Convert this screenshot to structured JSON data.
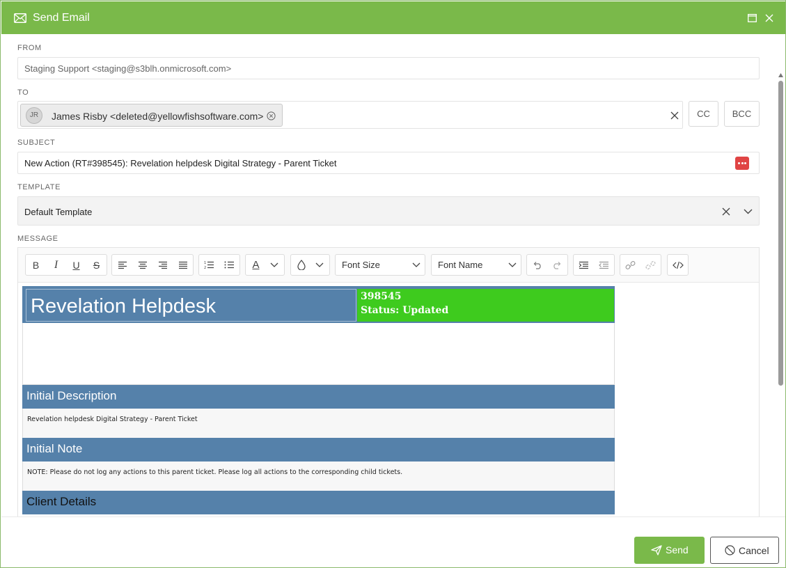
{
  "window": {
    "title": "Send Email"
  },
  "from": {
    "label": "FROM",
    "value": "Staging Support <staging@s3blh.onmicrosoft.com>"
  },
  "to": {
    "label": "TO",
    "recipients": [
      {
        "initials": "JR",
        "display": "James Risby <deleted@yellowfishsoftware.com>"
      }
    ],
    "cc_label": "CC",
    "bcc_label": "BCC"
  },
  "subject": {
    "label": "SUBJECT",
    "value": "New Action (RT#398545): Revelation helpdesk Digital Strategy - Parent Ticket"
  },
  "template": {
    "label": "TEMPLATE",
    "value": "Default Template"
  },
  "message": {
    "label": "MESSAGE",
    "toolbar": {
      "bold": "B",
      "italic": "I",
      "underline": "U",
      "strikethrough": "S",
      "font_color": "A",
      "font_size": "Font Size",
      "font_name": "Font Name"
    },
    "email": {
      "brand": "Revelation Helpdesk",
      "ticket_number": "398545",
      "status": "Status: Updated",
      "sections": [
        {
          "heading": "Initial Description",
          "body": "Revelation helpdesk Digital Strategy - Parent Ticket"
        },
        {
          "heading": "Initial Note",
          "body": "NOTE: Please do not log any actions to this parent ticket. Please log all actions to the corresponding child tickets."
        },
        {
          "heading": "Client Details",
          "body": ""
        }
      ]
    }
  },
  "footer": {
    "send_label": "Send",
    "cancel_label": "Cancel"
  },
  "colors": {
    "header_green": "#7ab94a",
    "template_blue": "#5581aa",
    "status_green": "#3ecb1e",
    "alert_red": "#e04444"
  }
}
